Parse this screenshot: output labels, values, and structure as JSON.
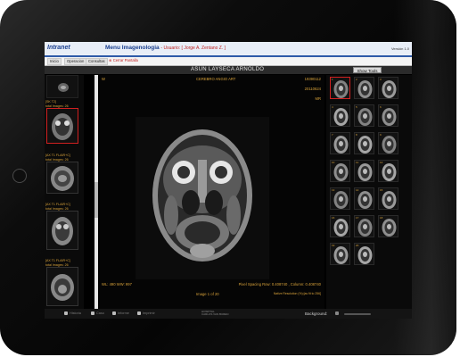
{
  "window": {
    "logo": "Intranet",
    "app_title": "Menu Imagenologia",
    "user_text": "- Usuario: [ Jorge A. Zentano Z. ]",
    "version": "Versión 1.0"
  },
  "menu": {
    "items": [
      "Inicio",
      "Operacion",
      "Consultas"
    ],
    "close_label": "Cerrar Pantalla"
  },
  "patient_bar": {
    "name": "ASUN LAYSECA ARNOLDO",
    "show_tools_label": "Show Tools"
  },
  "series": [
    {
      "label1": "",
      "label2": ""
    },
    {
      "label1": "[SK T2]",
      "label2": "total Images: 26"
    },
    {
      "label1": "[AX T1 FLAIR+C]",
      "label2": "total Images: 26"
    },
    {
      "label1": "[AX T1 FLAIR+C]",
      "label2": "total Images: 26"
    },
    {
      "label1": "[AX T1 FLAIR+C]",
      "label2": "total Images: 26"
    }
  ],
  "viewer": {
    "top_left": "W",
    "study": "CEREBRO ANGIO ART",
    "date1": "19390112",
    "date2": "20110624",
    "modality": "MR",
    "wl": "WL: 490 WW: 997",
    "pixel_spacing": "Pixel Spacing Row: 0.408740 , Column: 0.408740",
    "native_res": "Native Resolution (%):[as fit to 256]",
    "image_index": "Image 1 of 20"
  },
  "grid": {
    "numbers": [
      "1",
      "2",
      "3",
      "4",
      "5",
      "6",
      "7",
      "8",
      "9",
      "10",
      "11",
      "12",
      "13",
      "14",
      "15",
      "16",
      "17",
      "18",
      "19",
      "20"
    ]
  },
  "bottom": {
    "items": [
      "Historia",
      "Caso",
      "Informe",
      "Imprimir"
    ],
    "background_label": "Background:",
    "footer_logo_line1": "HOSPITAL",
    "footer_logo_line2": "CARLOS VAN BUREN"
  },
  "colors": {
    "accent": "#2e5aa8",
    "overlay_text": "#d8a23a",
    "selection": "#d02020"
  }
}
